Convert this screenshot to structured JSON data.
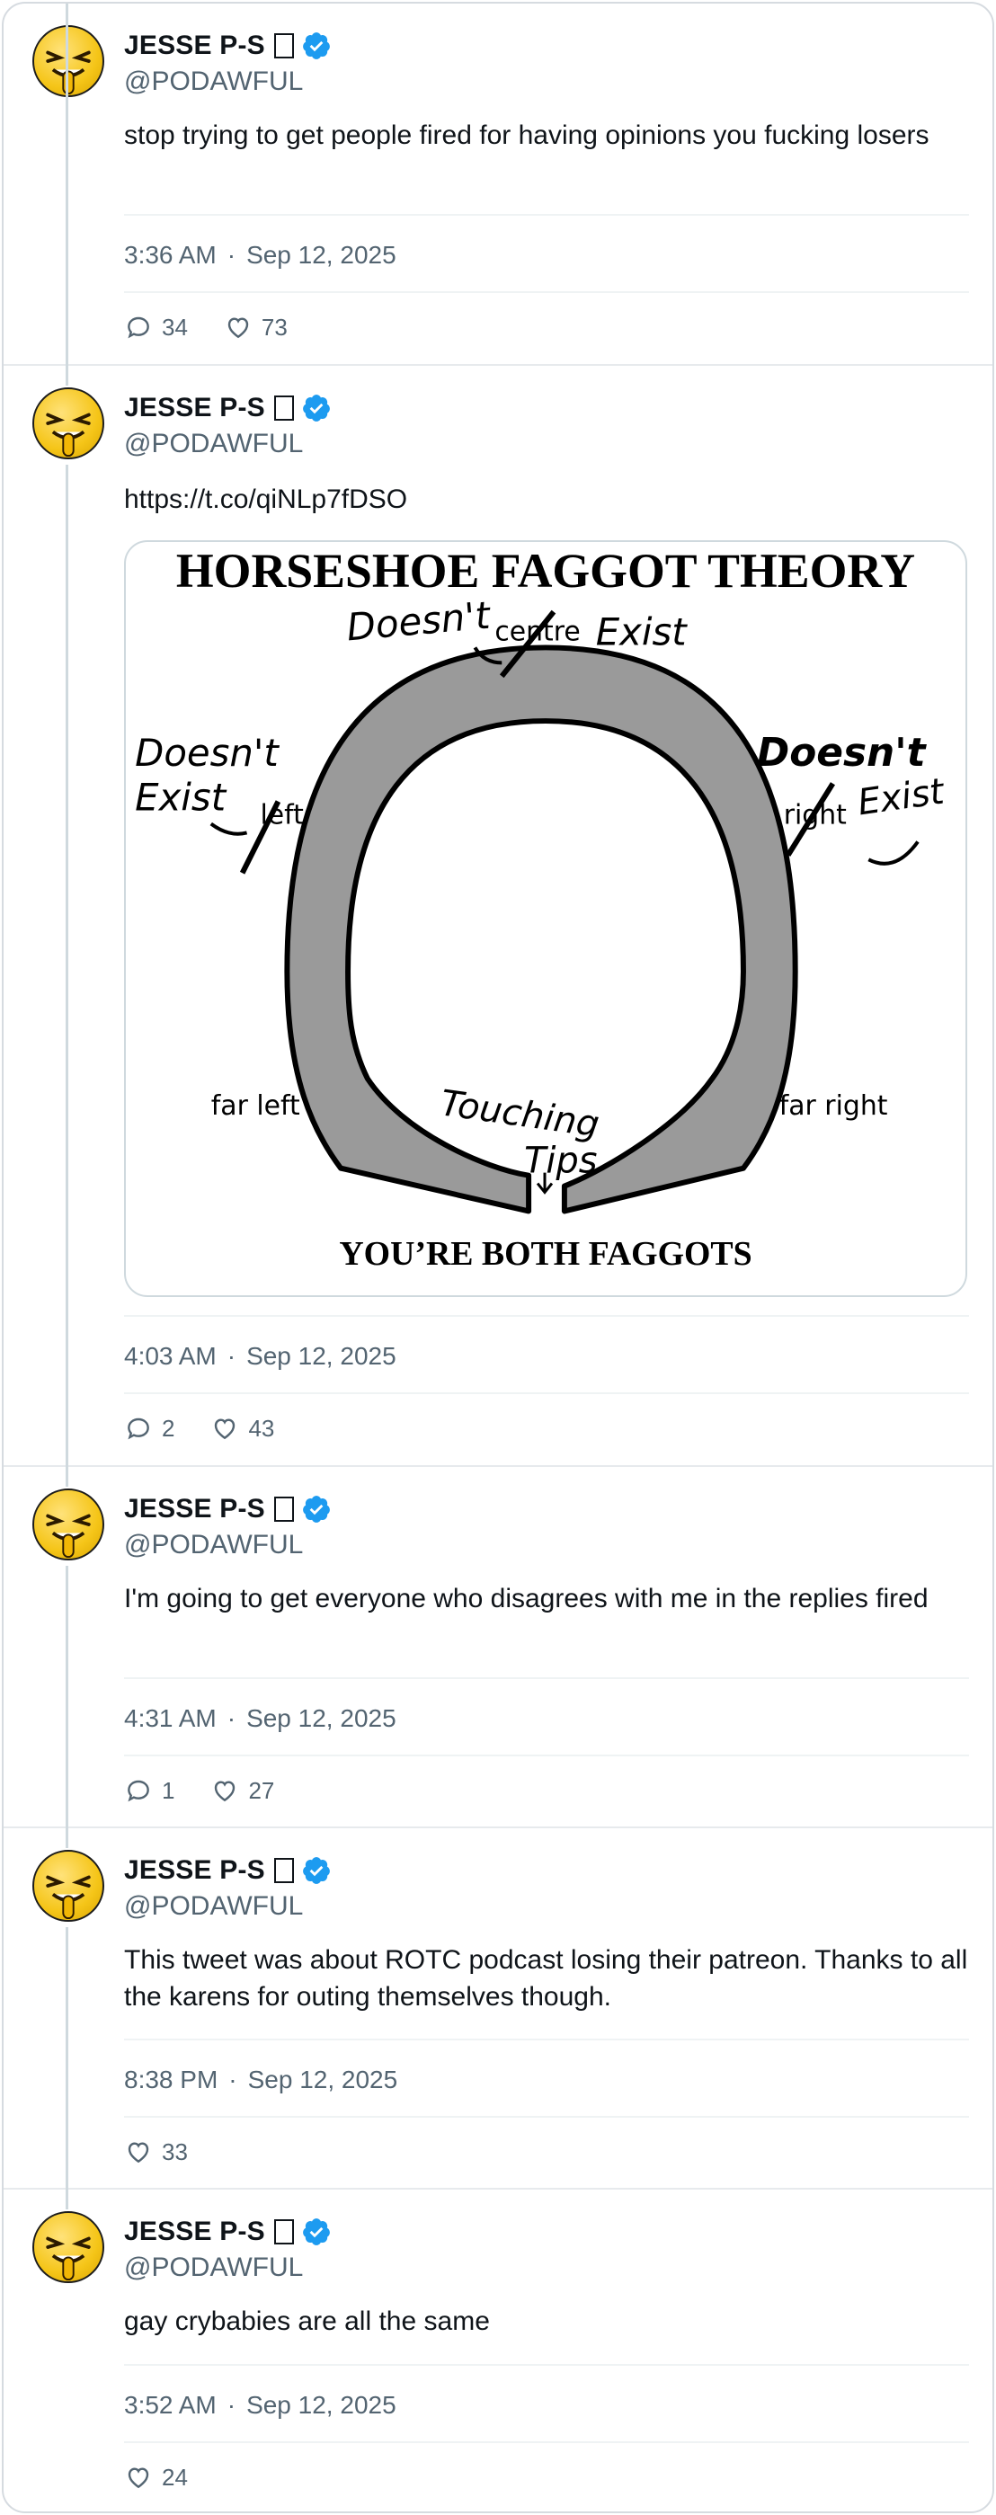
{
  "author": {
    "display_name": "JESSE P-S",
    "handle": "@PODAWFUL"
  },
  "tweets": [
    {
      "text": "stop trying to get people fired for having opinions you fucking losers",
      "time": "3:36 AM",
      "date": "Sep 12, 2025",
      "replies": "34",
      "likes": "73"
    },
    {
      "text": "https://t.co/qiNLp7fDSO",
      "time": "4:03 AM",
      "date": "Sep 12, 2025",
      "replies": "2",
      "likes": "43",
      "image": {
        "title": "HORSESHOE FAGGOT THEORY",
        "footer": "YOU’RE BOTH FAGGOTS",
        "label_centre": "centre",
        "label_left": "left",
        "label_right": "right",
        "label_far_left": "far left",
        "label_far_right": "far right",
        "scribble_doesnt": "Doesn't",
        "scribble_exist": "Exist",
        "scribble_touching": "Touching",
        "scribble_tips": "Tips"
      }
    },
    {
      "text": "I'm going to get everyone who disagrees with me in the replies fired",
      "time": "4:31 AM",
      "date": "Sep 12, 2025",
      "replies": "1",
      "likes": "27"
    },
    {
      "text": "This tweet was about ROTC podcast losing their patreon. Thanks to all the karens for outing themselves though.",
      "time": "8:38 PM",
      "date": "Sep 12, 2025",
      "likes": "33"
    },
    {
      "text": "gay crybabies are all the same",
      "time": "3:52 AM",
      "date": "Sep 12, 2025",
      "likes": "24"
    }
  ],
  "separator": "·",
  "colors": {
    "verified": "#1d9bf0",
    "muted": "#536471",
    "border": "#cfd9de",
    "horseshoe": "#9a9a9a"
  }
}
